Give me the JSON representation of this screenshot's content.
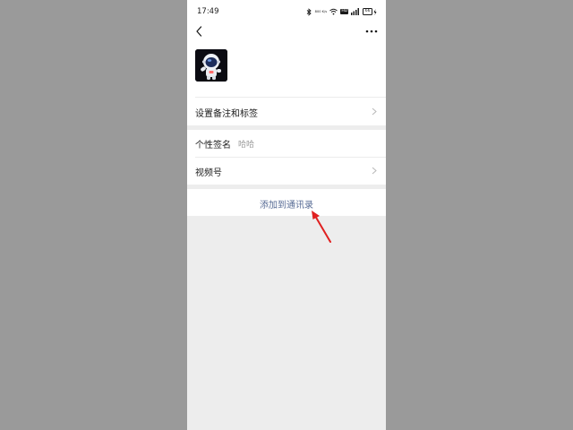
{
  "status_bar": {
    "time": "17:49",
    "icons": [
      "bluetooth-icon",
      "network-speed-icon",
      "wifi-icon",
      "hd-icon",
      "signal-icon",
      "battery-icon"
    ],
    "network_speed": "800 K/s",
    "hd": "HD",
    "battery": "66"
  },
  "nav": {
    "back_icon": "chevron-left-icon",
    "more_icon": "more-icon"
  },
  "profile": {
    "avatar_icon": "astronaut-avatar"
  },
  "rows": {
    "remark_tags": {
      "label": "设置备注和标签"
    },
    "signature": {
      "label": "个性签名",
      "value": "哈哈"
    },
    "channels": {
      "label": "视频号"
    }
  },
  "action": {
    "add_contact_label": "添加到通讯录"
  },
  "colors": {
    "accent_link": "#576b95",
    "annotation_arrow": "#e02020",
    "page_bg": "#ededed",
    "outer_bg": "#9a9a9a"
  }
}
